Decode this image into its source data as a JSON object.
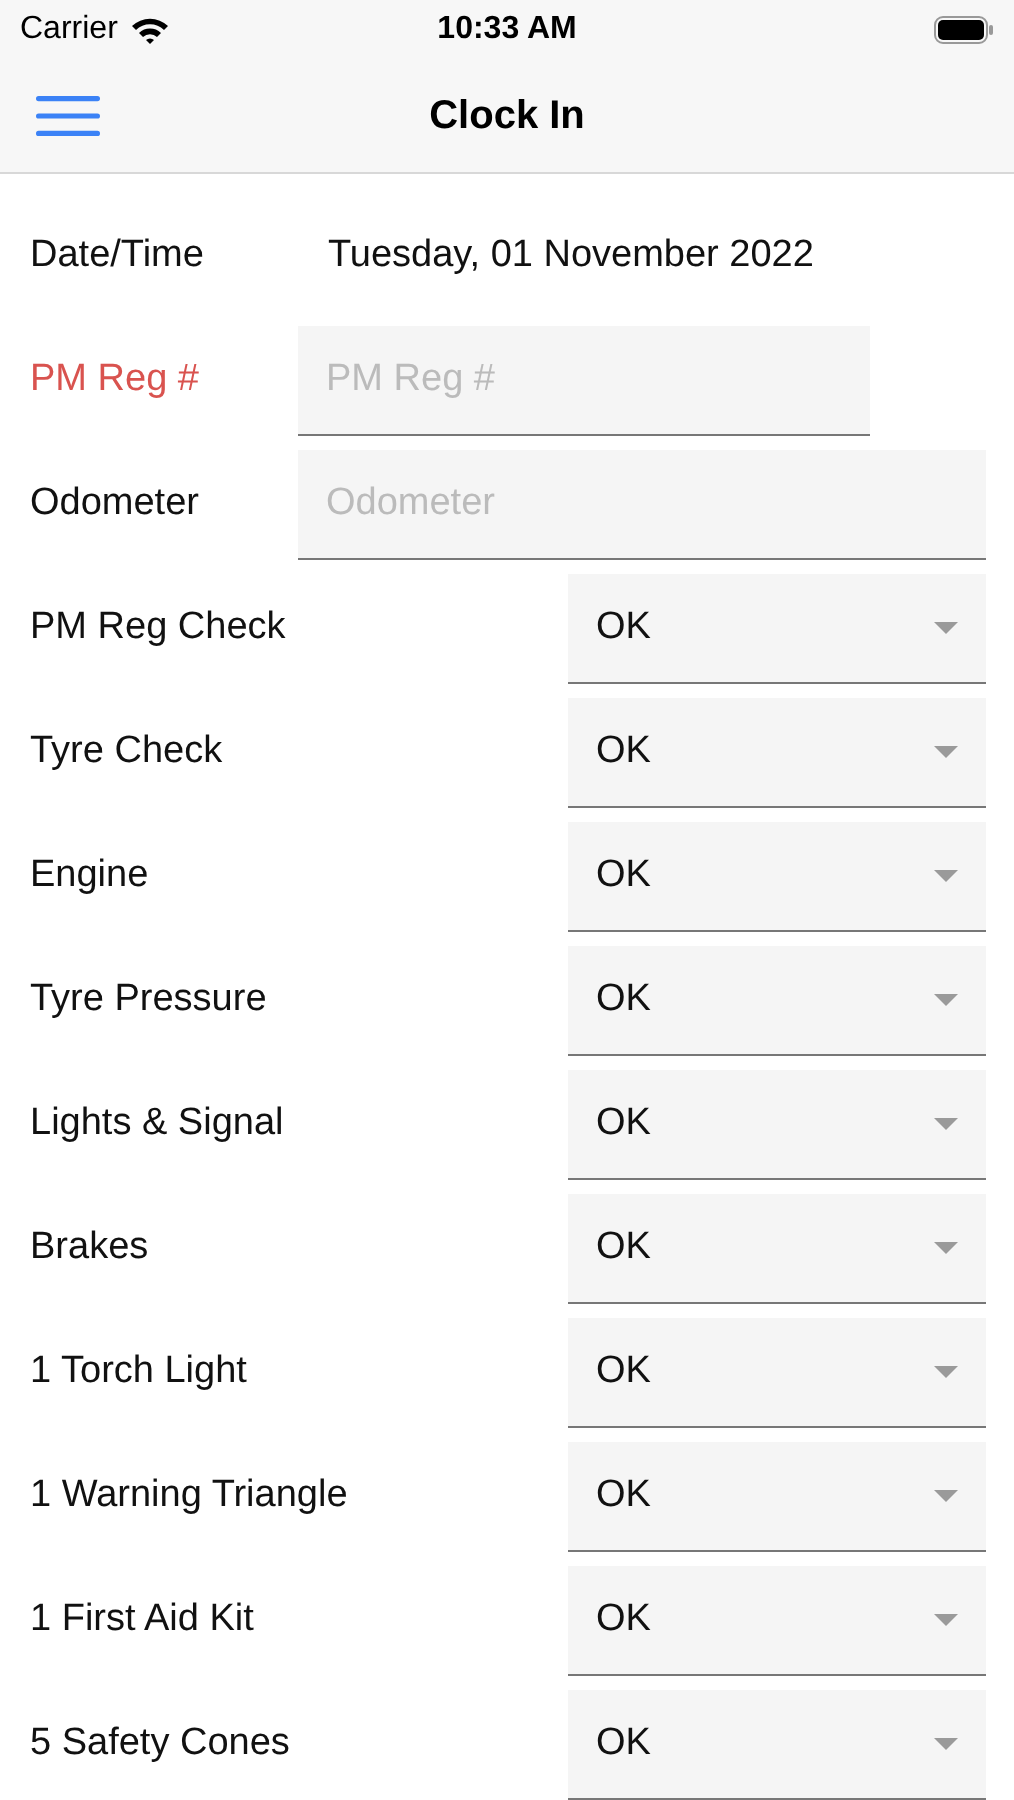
{
  "status_bar": {
    "carrier": "Carrier",
    "time": "10:33 AM"
  },
  "nav": {
    "title": "Clock In"
  },
  "rows": [
    {
      "kind": "text",
      "label": "Date/Time",
      "value": "Tuesday, 01 November 2022",
      "error": false
    },
    {
      "kind": "input",
      "label": "PM Reg #",
      "placeholder": "PM Reg #",
      "error": true,
      "narrow": true
    },
    {
      "kind": "input",
      "label": "Odometer",
      "placeholder": "Odometer",
      "error": false,
      "narrow": false
    },
    {
      "kind": "select",
      "label": "PM Reg Check",
      "value": "OK",
      "error": false
    },
    {
      "kind": "select",
      "label": "Tyre Check",
      "value": "OK",
      "error": false
    },
    {
      "kind": "select",
      "label": "Engine",
      "value": "OK",
      "error": false
    },
    {
      "kind": "select",
      "label": "Tyre Pressure",
      "value": "OK",
      "error": false
    },
    {
      "kind": "select",
      "label": "Lights & Signal",
      "value": "OK",
      "error": false
    },
    {
      "kind": "select",
      "label": "Brakes",
      "value": "OK",
      "error": false
    },
    {
      "kind": "select",
      "label": "1 Torch Light",
      "value": "OK",
      "error": false
    },
    {
      "kind": "select",
      "label": "1 Warning Triangle",
      "value": "OK",
      "error": false
    },
    {
      "kind": "select",
      "label": "1 First Aid Kit",
      "value": "OK",
      "error": false
    },
    {
      "kind": "select",
      "label": "5 Safety Cones",
      "value": "OK",
      "error": false
    }
  ]
}
